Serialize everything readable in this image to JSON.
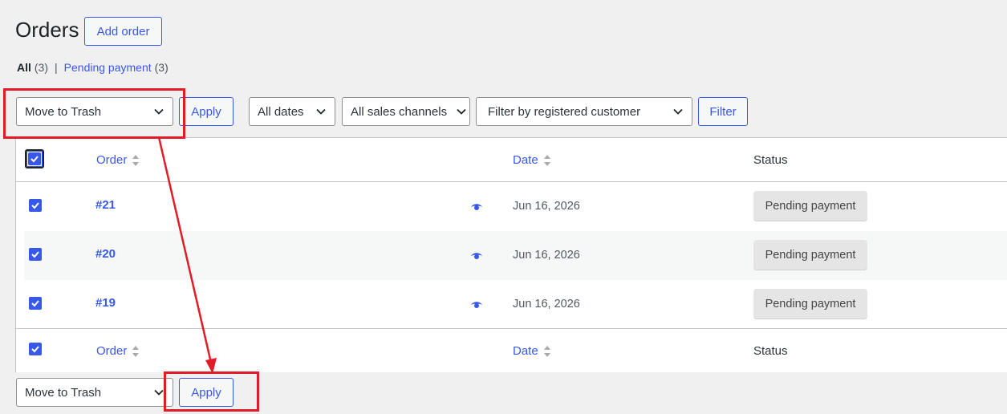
{
  "header": {
    "title": "Orders",
    "add_label": "Add order"
  },
  "views": {
    "all_label": "All",
    "all_count": "(3)",
    "separator": "|",
    "pending_label": "Pending payment",
    "pending_count": "(3)"
  },
  "filters": {
    "bulk_action": "Move to Trash",
    "apply_label": "Apply",
    "dates": "All dates",
    "channels": "All sales channels",
    "customer": "Filter by registered customer",
    "filter_label": "Filter"
  },
  "table": {
    "columns": {
      "order": "Order",
      "date": "Date",
      "status": "Status"
    },
    "rows": [
      {
        "order": "#21",
        "date": "Jun 16, 2026",
        "status": "Pending payment"
      },
      {
        "order": "#20",
        "date": "Jun 16, 2026",
        "status": "Pending payment"
      },
      {
        "order": "#19",
        "date": "Jun 16, 2026",
        "status": "Pending payment"
      }
    ]
  },
  "bottom": {
    "bulk_action": "Move to Trash",
    "apply_label": "Apply"
  },
  "colors": {
    "accent": "#3858e9",
    "annotation": "#e21c26"
  }
}
